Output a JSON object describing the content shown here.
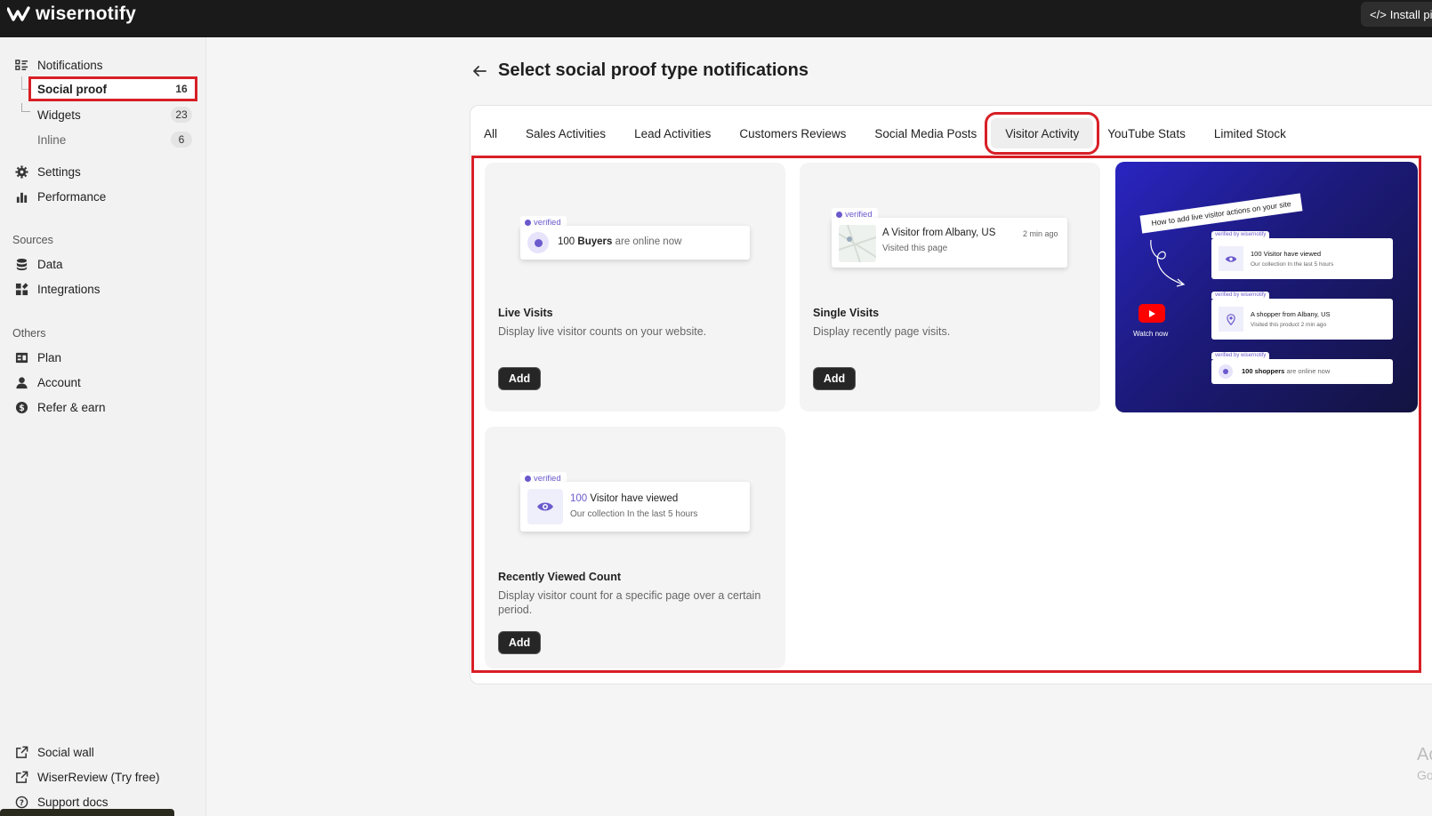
{
  "app": {
    "logo_text": "wisernotify",
    "install_label": "Install pi"
  },
  "sidebar": {
    "notifications": "Notifications",
    "social_proof": {
      "label": "Social proof",
      "count": "16"
    },
    "widgets": {
      "label": "Widgets",
      "count": "23"
    },
    "inline": {
      "label": "Inline",
      "count": "6"
    },
    "settings": "Settings",
    "performance": "Performance",
    "sources_label": "Sources",
    "data": "Data",
    "integrations": "Integrations",
    "others_label": "Others",
    "plan": "Plan",
    "account": "Account",
    "refer": "Refer & earn",
    "social_wall": "Social wall",
    "wiserreview": "WiserReview (Try free)",
    "support": "Support docs"
  },
  "main": {
    "title": "Select social proof type notifications",
    "tabs": [
      "All",
      "Sales Activities",
      "Lead Activities",
      "Customers Reviews",
      "Social Media Posts",
      "Visitor Activity",
      "YouTube Stats",
      "Limited Stock"
    ],
    "active_tab": "Visitor Activity",
    "cards": {
      "live": {
        "title": "Live Visits",
        "desc": "Display live visitor counts on your website.",
        "add": "Add",
        "preview": {
          "verified": "verified",
          "count": "100",
          "bold": "Buyers",
          "rest": "are online now"
        }
      },
      "single": {
        "title": "Single Visits",
        "desc": "Display recently page visits.",
        "add": "Add",
        "preview": {
          "verified": "verified",
          "headline": "A Visitor from Albany, US",
          "time": "2 min ago",
          "sub": "Visited this page"
        }
      },
      "recent": {
        "title": "Recently Viewed Count",
        "desc": "Display visitor count for a specific page over a certain period.",
        "add": "Add",
        "preview": {
          "verified": "verified",
          "count": "100",
          "headline": "Visitor have viewed",
          "sub": "Our collection In the last 5 hours"
        }
      }
    },
    "video": {
      "banner": "How to add live visitor actions on your site",
      "watch": "Watch now",
      "tag": "verified by wisernotify",
      "n1_title": "100 Visitor have viewed",
      "n1_sub": "Our collection In the last 5 hours",
      "n2_title": "A shopper from Albany, US",
      "n2_sub": "Visited this product 2 min ago",
      "n3_title": "100 shoppers",
      "n3_rest": "are online now"
    },
    "ghost_1": "Ac",
    "ghost_2": "Go"
  },
  "colors": {
    "highlight": "#d81f26",
    "accent": "#6a5acd",
    "topbar": "#1a1a1a"
  }
}
